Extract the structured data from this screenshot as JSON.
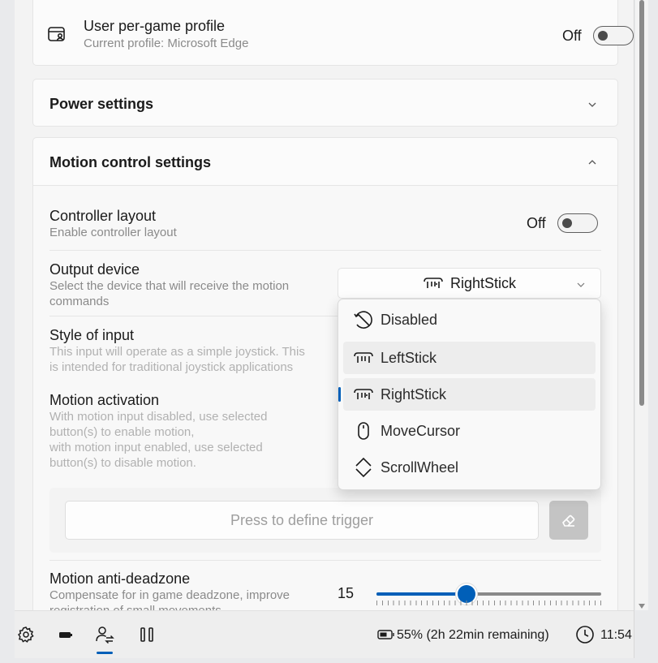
{
  "per_game_profile": {
    "title": "User per-game profile",
    "subtitle": "Current profile: Microsoft Edge",
    "toggle_label": "Off"
  },
  "power_settings": {
    "title": "Power settings"
  },
  "motion_control": {
    "title": "Motion control settings",
    "controller_layout": {
      "title": "Controller layout",
      "subtitle": "Enable controller layout",
      "toggle_label": "Off"
    },
    "output_device": {
      "title": "Output device",
      "subtitle_line1": "Select the device that will receive the motion",
      "subtitle_line2": "commands",
      "selected": "RightStick",
      "options": [
        "Disabled",
        "LeftStick",
        "RightStick",
        "MoveCursor",
        "ScrollWheel"
      ]
    },
    "style_of_input": {
      "title": "Style of input",
      "subtitle_line1": "This input will operate as a simple joystick. This",
      "subtitle_line2": "is intended for traditional joystick applications"
    },
    "motion_activation": {
      "title": "Motion activation",
      "line1": "With motion input disabled, use selected",
      "line2": "button(s) to enable motion,",
      "line3": "with motion input enabled, use selected",
      "line4": "button(s) to disable motion."
    },
    "trigger_placeholder": "Press to define trigger",
    "anti_deadzone": {
      "title": "Motion anti-deadzone",
      "subtitle_line1": "Compensate for in game deadzone, improve",
      "subtitle_line2": "registration of small movements",
      "value": "15",
      "fraction": 0.4
    }
  },
  "bottombar": {
    "battery": "55% (2h 22min remaining)",
    "time": "11:54"
  },
  "colors": {
    "accent": "#005fb8"
  }
}
